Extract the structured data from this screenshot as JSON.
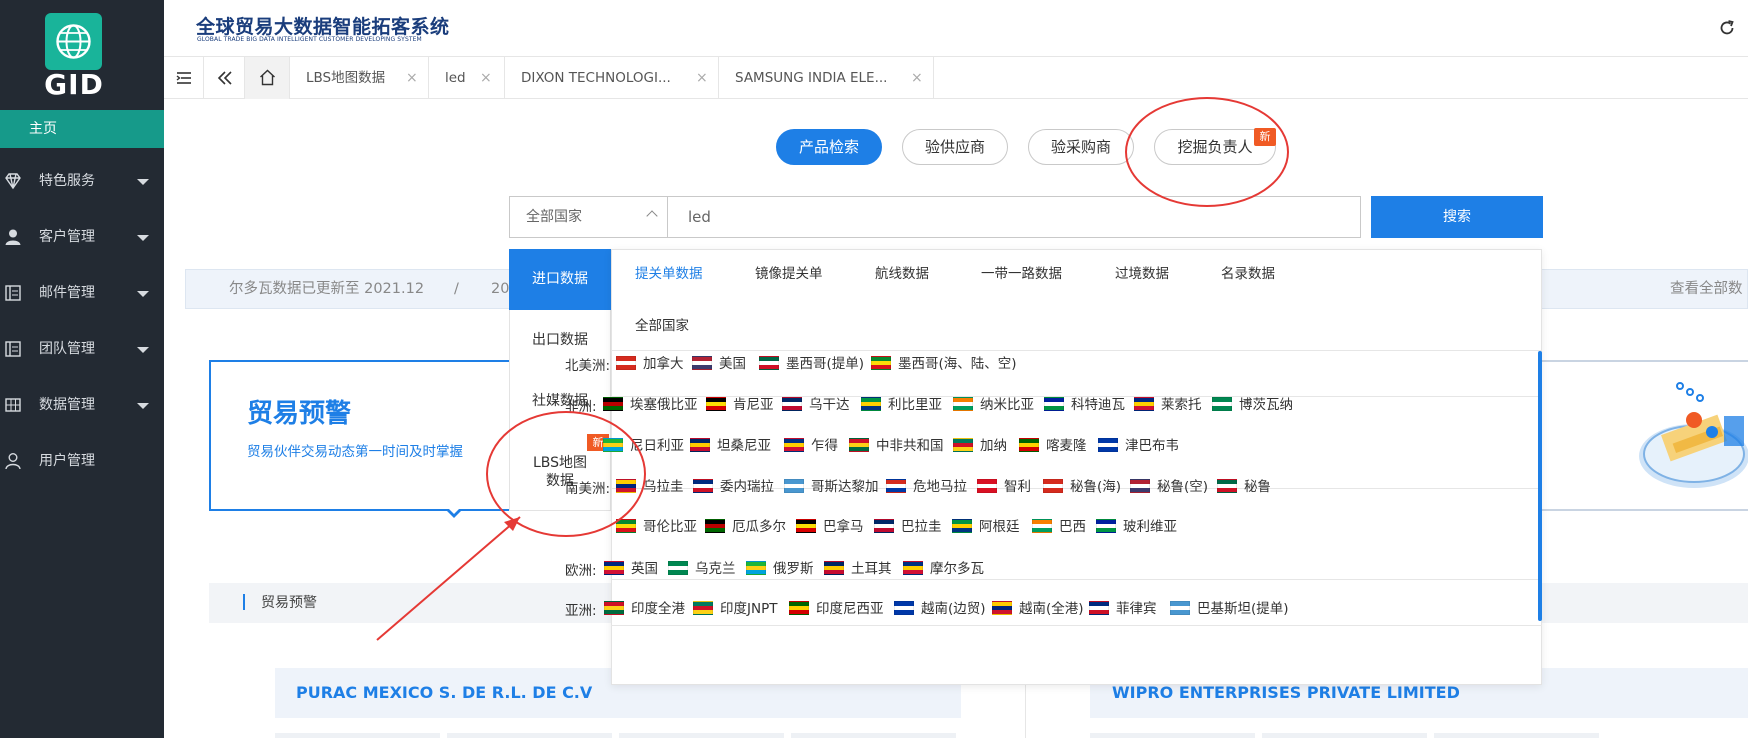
{
  "app": {
    "logo_text": "GID",
    "title": "全球贸易大数据智能拓客系统",
    "subtitle": "GLOBAL TRADE BIG DATA INTELLIGENT CUSTOMER DEVELOPING SYSTEM"
  },
  "sidebar": {
    "home": "主页",
    "items": [
      {
        "label": "特色服务",
        "icon": "diamond-icon"
      },
      {
        "label": "客户管理",
        "icon": "user-icon"
      },
      {
        "label": "邮件管理",
        "icon": "mail-icon"
      },
      {
        "label": "团队管理",
        "icon": "team-icon"
      },
      {
        "label": "数据管理",
        "icon": "grid-icon"
      },
      {
        "label": "用户管理",
        "icon": "user-outline-icon"
      }
    ]
  },
  "tabs": [
    {
      "label": "LBS地图数据",
      "close": "×"
    },
    {
      "label": "led",
      "close": "×"
    },
    {
      "label": "DIXON TECHNOLOGI...",
      "close": "×"
    },
    {
      "label": "SAMSUNG INDIA ELE...",
      "close": "×"
    }
  ],
  "search": {
    "modes": [
      "产品检索",
      "验供应商",
      "验采购商",
      "挖掘负责人"
    ],
    "new_badge": "新",
    "country_select": "全部国家",
    "query": "led",
    "button": "搜索"
  },
  "info_bar": {
    "text": "尔多瓦数据已更新至 2021.12",
    "separator": "/",
    "text2": "20",
    "view_all": "查看全部数"
  },
  "trade_warning": {
    "title": "贸易预警",
    "subtitle": "贸易伙伴交易动态第一时间及时掌握"
  },
  "section": {
    "title": "贸易预警",
    "company_left": "PURAC MEXICO S. DE R.L. DE C.V",
    "company_right": "WIPRO ENTERPRISES PRIVATE LIMITED"
  },
  "dropdown": {
    "categories": [
      "进口数据",
      "出口数据",
      "社媒数据",
      "LBS地图\n数据"
    ],
    "category_lbs_line1": "LBS地图",
    "category_lbs_line2": "数据",
    "new_badge": "新",
    "data_tabs": [
      "提关单数据",
      "镜像提关单",
      "航线数据",
      "一带一路数据",
      "过境数据",
      "名录数据"
    ],
    "all_countries": "全部国家",
    "regions": [
      {
        "label": "北美洲:",
        "countries": [
          "加拿大",
          "美国",
          "墨西哥(提单)",
          "墨西哥(海、陆、空)"
        ]
      },
      {
        "label": "非洲:",
        "countries": [
          "埃塞俄比亚",
          "肯尼亚",
          "乌干达",
          "利比里亚",
          "纳米比亚",
          "科特迪瓦",
          "莱索托",
          "博茨瓦纳",
          "尼日利亚",
          "坦桑尼亚",
          "乍得",
          "中非共和国",
          "加纳",
          "喀麦隆",
          "津巴布韦"
        ]
      },
      {
        "label": "南美洲:",
        "countries": [
          "乌拉圭",
          "委内瑞拉",
          "哥斯达黎加",
          "危地马拉",
          "智利",
          "秘鲁(海)",
          "秘鲁(空)",
          "秘鲁",
          "哥伦比亚",
          "厄瓜多尔",
          "巴拿马",
          "巴拉圭",
          "阿根廷",
          "巴西",
          "玻利维亚"
        ]
      },
      {
        "label": "欧洲:",
        "countries": [
          "英国",
          "乌克兰",
          "俄罗斯",
          "土耳其",
          "摩尔多瓦"
        ]
      },
      {
        "label": "亚洲:",
        "countries": [
          "印度全港",
          "印度JNPT",
          "印度尼西亚",
          "越南(边贸)",
          "越南(全港)",
          "菲律宾",
          "巴基斯坦(提单)"
        ]
      }
    ]
  },
  "colors": {
    "accent": "#1e7fe6",
    "sidebar_bg": "#232a33",
    "sidebar_active": "#169a8a",
    "badge": "#f05a24",
    "annotation": "#e53935"
  }
}
